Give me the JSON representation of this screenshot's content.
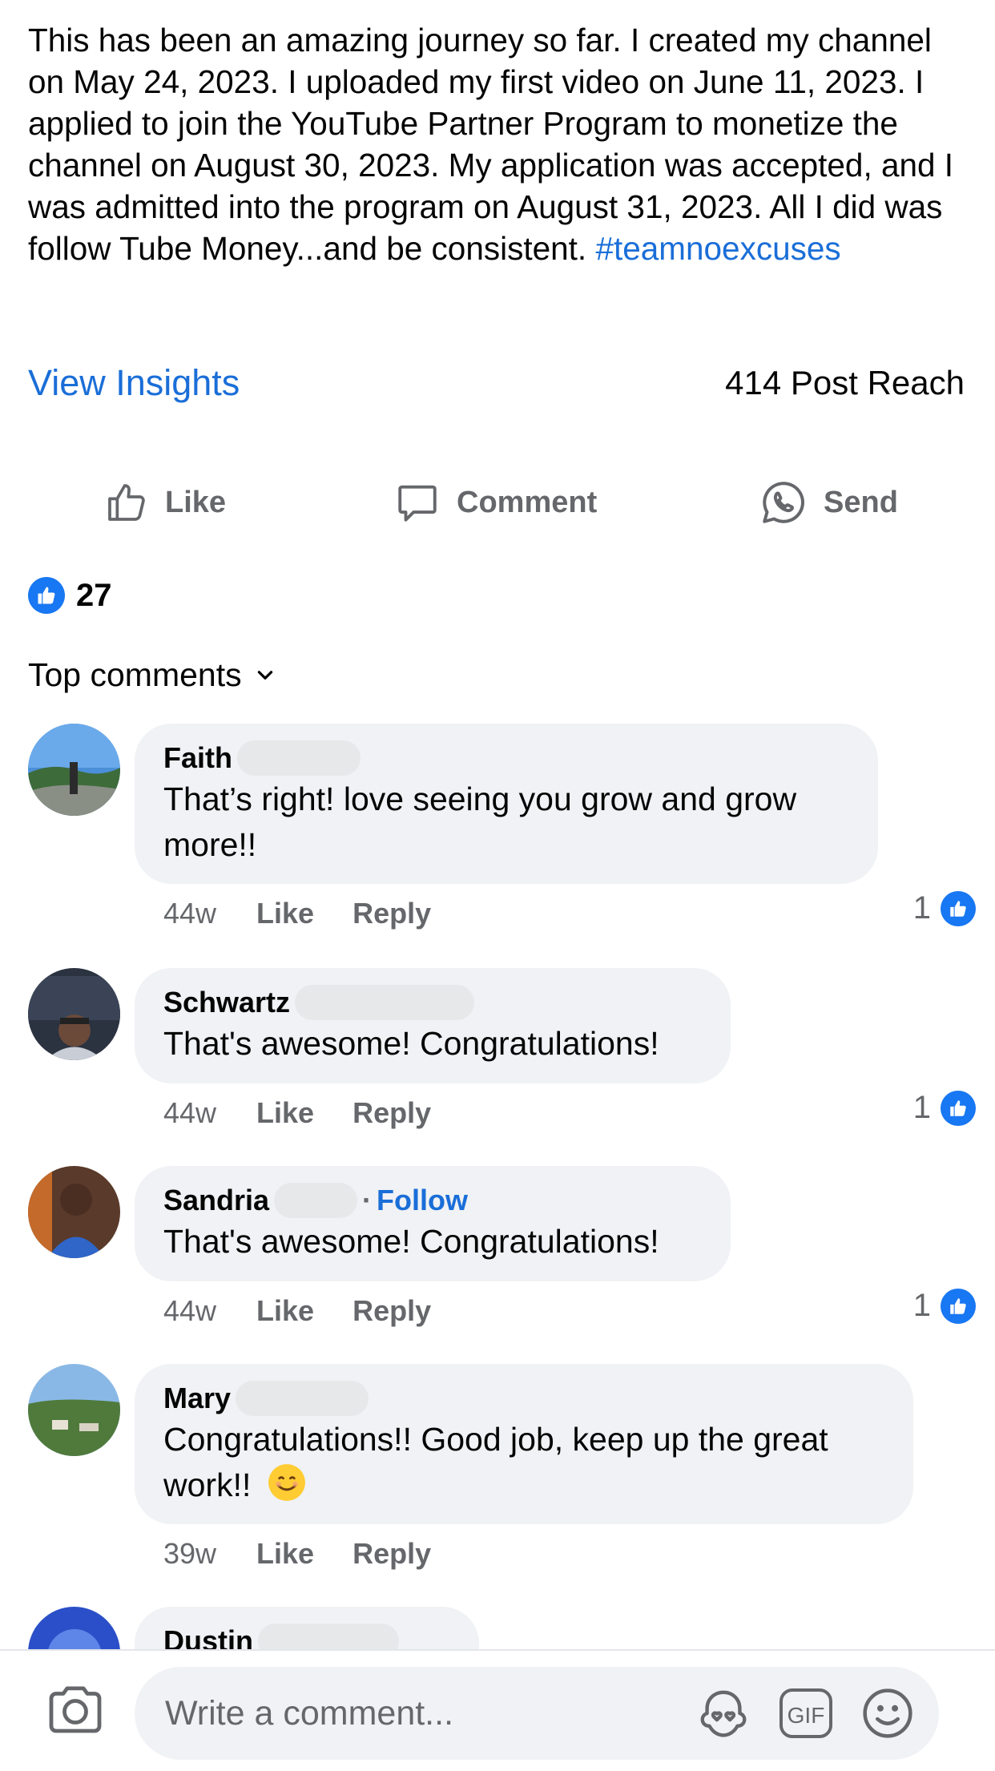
{
  "post": {
    "text": "This has been an amazing journey so far. I created my channel on May 24, 2023. I uploaded my first video on June 11, 2023. I applied to join the YouTube Partner Program to monetize the channel on August 30, 2023. My application was accepted, and I was admitted into the program on August 31, 2023. All I did was follow Tube Money...and be consistent.",
    "hashtag": "#teamnoexcuses",
    "view_insights_label": "View Insights",
    "reach_text": "414 Post Reach"
  },
  "actions": {
    "like_label": "Like",
    "comment_label": "Comment",
    "send_label": "Send"
  },
  "reactions": {
    "count": "27"
  },
  "comments_sort": {
    "label": "Top comments"
  },
  "comments": [
    {
      "author": "Faith",
      "text": "That’s right! love seeing you grow and grow more!!",
      "time": "44w",
      "like_label": "Like",
      "reply_label": "Reply",
      "reactions": "1"
    },
    {
      "author": "Schwartz",
      "text": "That's awesome! Congratulations!",
      "time": "44w",
      "like_label": "Like",
      "reply_label": "Reply",
      "reactions": "1"
    },
    {
      "author": "Sandria",
      "follow_label": "Follow",
      "text": "That's awesome! Congratulations!",
      "time": "44w",
      "like_label": "Like",
      "reply_label": "Reply",
      "reactions": "1"
    },
    {
      "author": "Mary",
      "text": "Congratulations!! Good job, keep up the great work!!",
      "time": "39w",
      "like_label": "Like",
      "reply_label": "Reply"
    },
    {
      "author": "Dustin"
    }
  ],
  "composer": {
    "placeholder": "Write a comment...",
    "gif_label": "GIF"
  },
  "colors": {
    "accent": "#1877f2",
    "link": "#1a6ed8",
    "muted": "#65676b",
    "bubble": "#f0f2f5"
  }
}
